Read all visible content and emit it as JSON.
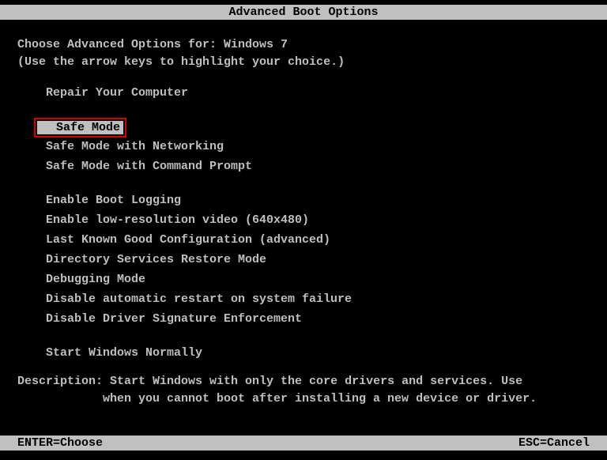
{
  "title": "Advanced Boot Options",
  "instruction_line1": "Choose Advanced Options for: Windows 7",
  "instruction_line2": "(Use the arrow keys to highlight your choice.)",
  "options": {
    "group1": [
      "Repair Your Computer"
    ],
    "selected": "Safe Mode",
    "group2": [
      "Safe Mode with Networking",
      "Safe Mode with Command Prompt"
    ],
    "group3": [
      "Enable Boot Logging",
      "Enable low-resolution video (640x480)",
      "Last Known Good Configuration (advanced)",
      "Directory Services Restore Mode",
      "Debugging Mode",
      "Disable automatic restart on system failure",
      "Disable Driver Signature Enforcement"
    ],
    "group4": [
      "Start Windows Normally"
    ]
  },
  "description": {
    "line1": "Description: Start Windows with only the core drivers and services. Use",
    "line2": "when you cannot boot after installing a new device or driver."
  },
  "footer": {
    "left": "ENTER=Choose",
    "right": "ESC=Cancel"
  }
}
